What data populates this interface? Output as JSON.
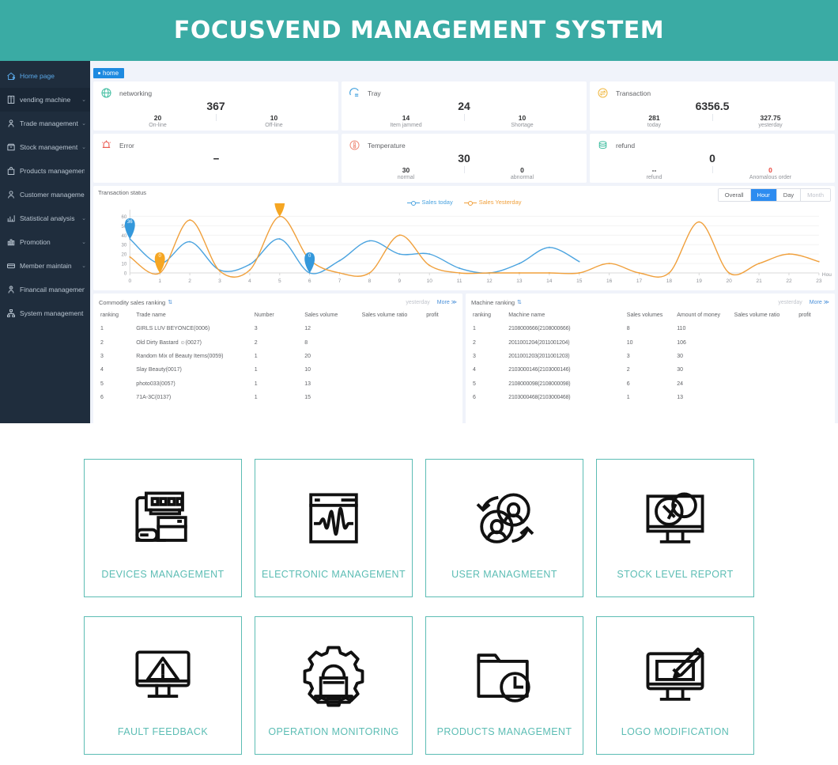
{
  "header": {
    "title": "FOCUSVEND MANAGEMENT SYSTEM",
    "bg": "#3aaba4"
  },
  "sidebar": {
    "items": [
      {
        "label": "Home page",
        "icon": "home-icon",
        "arrow": "",
        "active": true
      },
      {
        "label": "vending machine",
        "icon": "machine-icon",
        "arrow": "⌄",
        "active": false
      },
      {
        "label": "Trade management",
        "icon": "trade-icon",
        "arrow": "⌄",
        "active": false
      },
      {
        "label": "Stock management",
        "icon": "stock-icon",
        "arrow": "⌄",
        "active": false
      },
      {
        "label": "Products management",
        "icon": "products-icon",
        "arrow": "",
        "active": false
      },
      {
        "label": "Customer management",
        "icon": "customer-icon",
        "arrow": "",
        "active": false
      },
      {
        "label": "Statistical analysis",
        "icon": "chart-icon",
        "arrow": "⌄",
        "active": false
      },
      {
        "label": "Promotion",
        "icon": "promotion-icon",
        "arrow": "⌄",
        "active": false
      },
      {
        "label": "Member maintain",
        "icon": "member-icon",
        "arrow": "⌄",
        "active": false
      },
      {
        "label": "Financail management",
        "icon": "finance-icon",
        "arrow": "",
        "active": false
      },
      {
        "label": "System management",
        "icon": "system-icon",
        "arrow": "",
        "active": false
      }
    ]
  },
  "breadcrumb": {
    "label": "home"
  },
  "stats": [
    {
      "title": "networking",
      "icon": "globe-icon",
      "main": "367",
      "left_value": "20",
      "left_key": "On-line",
      "right_value": "10",
      "right_key": "Off-line",
      "right_red": false
    },
    {
      "title": "Tray",
      "icon": "tray-icon",
      "main": "24",
      "left_value": "14",
      "left_key": "Item jammed",
      "right_value": "10",
      "right_key": "Shortage",
      "right_red": false
    },
    {
      "title": "Transaction",
      "icon": "exchange-icon",
      "main": "6356.5",
      "left_value": "281",
      "left_key": "today",
      "right_value": "327.75",
      "right_key": "yesterday",
      "right_red": false
    },
    {
      "title": "Error",
      "icon": "alarm-icon",
      "main": "--",
      "left_value": "",
      "left_key": "",
      "right_value": "",
      "right_key": "",
      "right_red": false
    },
    {
      "title": "Temperature",
      "icon": "thermo-icon",
      "main": "30",
      "left_value": "30",
      "left_key": "normal",
      "right_value": "0",
      "right_key": "abnormal",
      "right_red": false
    },
    {
      "title": "refund",
      "icon": "coins-icon",
      "main": "0",
      "left_value": "--",
      "left_key": "refund",
      "right_value": "0",
      "right_key": "Anomalous order",
      "right_red": true
    }
  ],
  "chart_panel": {
    "title": "Transaction status",
    "range_buttons": [
      {
        "label": "Overall",
        "state": "normal"
      },
      {
        "label": "Hour",
        "state": "active"
      },
      {
        "label": "Day",
        "state": "normal"
      },
      {
        "label": "Month",
        "state": "muted"
      }
    ]
  },
  "chart_data": {
    "type": "line",
    "title": "Transaction status",
    "xlabel": "Hou",
    "ylabel": "",
    "ylim": [
      0,
      62
    ],
    "yticks": [
      0,
      10,
      20,
      30,
      40,
      50,
      60
    ],
    "grid": true,
    "legend_position": "top-center",
    "x": [
      0,
      1,
      2,
      3,
      4,
      5,
      6,
      7,
      8,
      9,
      10,
      11,
      12,
      13,
      14,
      15,
      16,
      17,
      18,
      19,
      20,
      21,
      22,
      23
    ],
    "series": [
      {
        "name": "Sales today",
        "color": "#4aa3df",
        "values": [
          36,
          10,
          33,
          3,
          9,
          36,
          0,
          13,
          34,
          20,
          20,
          5,
          0,
          10,
          27,
          12,
          null,
          null,
          null,
          null,
          null,
          null,
          null,
          null
        ]
      },
      {
        "name": "Sales Yesterday",
        "color": "#f0a03c",
        "values": [
          17,
          0,
          56,
          2,
          3,
          59.75,
          14,
          0,
          0,
          40,
          8,
          0,
          0,
          0,
          0,
          0,
          10,
          0,
          0,
          54,
          0,
          10,
          20,
          12
        ]
      }
    ],
    "annotations": [
      {
        "series": "Sales today",
        "x": 0,
        "value": "36",
        "color": "#3498db"
      },
      {
        "series": "Sales Yesterday",
        "x": 1,
        "value": "0",
        "color": "#f5a623"
      },
      {
        "series": "Sales Yesterday",
        "x": 5,
        "value": "59.75",
        "color": "#f5a623"
      },
      {
        "series": "Sales today",
        "x": 6,
        "value": "0",
        "color": "#3498db"
      }
    ]
  },
  "commodity_ranking": {
    "title": "Commodity sales ranking",
    "sort_icon": "sort-icon",
    "period_label": "yesterday",
    "more_label": "More ≫",
    "columns": [
      "ranking",
      "Trade name",
      "Number",
      "Sales volume",
      "Sales volume ratio",
      "profit"
    ],
    "rows": [
      [
        "1",
        "GIRLS LUV BEYONCE(0006)",
        "3",
        "12",
        "",
        ""
      ],
      [
        "2",
        "Old Dirty Bastard ☺(0027)",
        "2",
        "8",
        "",
        ""
      ],
      [
        "3",
        "Random Mix of Beauty Items(0059)",
        "1",
        "20",
        "",
        ""
      ],
      [
        "4",
        "Slay Beauty(0017)",
        "1",
        "10",
        "",
        ""
      ],
      [
        "5",
        "photo033(0057)",
        "1",
        "13",
        "",
        ""
      ],
      [
        "6",
        "71A-3C(0137)",
        "1",
        "15",
        "",
        ""
      ]
    ]
  },
  "machine_ranking": {
    "title": "Machine ranking",
    "sort_icon": "sort-icon",
    "period_label": "yesterday",
    "more_label": "More ≫",
    "columns": [
      "ranking",
      "Machine name",
      "Sales volumes",
      "Amount of money",
      "Sales volume ratio",
      "profit"
    ],
    "rows": [
      [
        "1",
        "2108000666(2108000666)",
        "8",
        "110",
        "",
        ""
      ],
      [
        "2",
        "2011001204(2011001204)",
        "10",
        "106",
        "",
        ""
      ],
      [
        "3",
        "2011001203(2011001203)",
        "3",
        "30",
        "",
        ""
      ],
      [
        "4",
        "2103000146(2103000146)",
        "2",
        "30",
        "",
        ""
      ],
      [
        "5",
        "2108000098(2108000098)",
        "6",
        "24",
        "",
        ""
      ],
      [
        "6",
        "2103000468(2103000468)",
        "1",
        "13",
        "",
        ""
      ]
    ]
  },
  "features": {
    "accent": "#5cbdb4",
    "rows": [
      [
        {
          "label": "DEVICES MANAGEMENT",
          "icon": "devices-icon"
        },
        {
          "label": "ELECTRONIC MANAGEMENT",
          "icon": "waveform-window-icon"
        },
        {
          "label": "USER MANAGMEENT",
          "icon": "users-sync-icon"
        },
        {
          "label": "STOCK LEVEL REPORT",
          "icon": "monitor-rings-icon"
        }
      ],
      [
        {
          "label": "FAULT FEEDBACK",
          "icon": "monitor-warning-icon"
        },
        {
          "label": "OPERATION MONITORING",
          "icon": "gear-laptop-icon"
        },
        {
          "label": "PRODUCTS MANAGEMENT",
          "icon": "folder-clock-icon"
        },
        {
          "label": "LOGO MODIFICATION",
          "icon": "monitor-brush-icon"
        }
      ]
    ]
  }
}
